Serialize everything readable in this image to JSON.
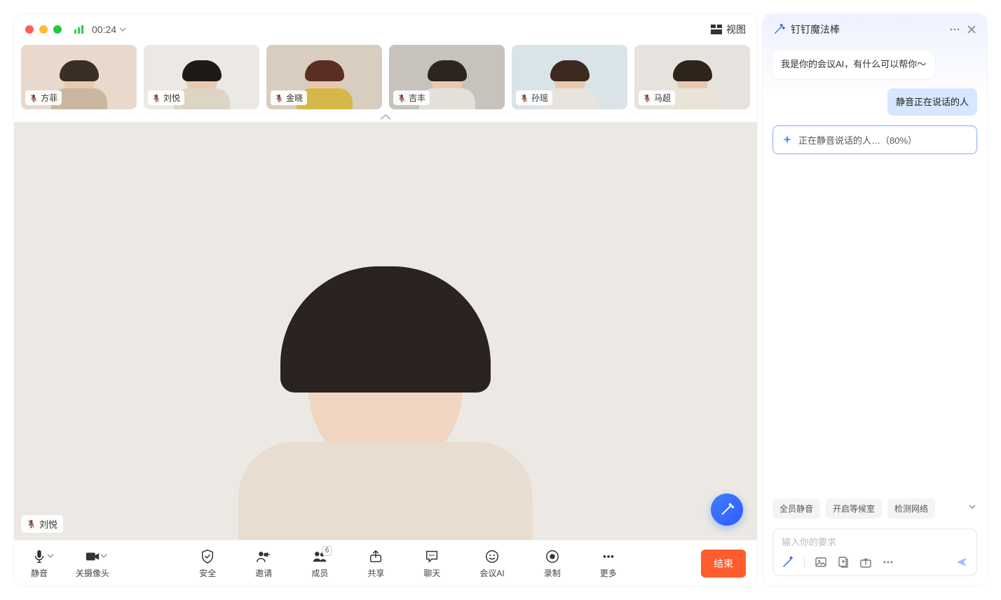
{
  "header": {
    "timer": "00:24",
    "view_label": "视图"
  },
  "participants": [
    {
      "name": "方菲",
      "bg": "#e8d9cc",
      "hair": "#3a2e26",
      "shirt": "#c9b89f"
    },
    {
      "name": "刘悦",
      "bg": "#ece9e5",
      "hair": "#1f1a17",
      "shirt": "#ded4c4"
    },
    {
      "name": "金晓",
      "bg": "#d9cdbf",
      "hair": "#5a2e22",
      "shirt": "#d4b84a"
    },
    {
      "name": "吉丰",
      "bg": "#c7c2bb",
      "hair": "#2b241f",
      "shirt": "#e3e0da"
    },
    {
      "name": "孙瑶",
      "bg": "#d9e4e9",
      "hair": "#3c2a20",
      "shirt": "#e8e3dc"
    },
    {
      "name": "马超",
      "bg": "#e6e3de",
      "hair": "#2e241c",
      "shirt": "#eae4d8"
    }
  ],
  "speaker": {
    "name": "刘悦"
  },
  "controls": {
    "mute": "静音",
    "camera": "关摄像头",
    "security": "安全",
    "invite": "邀请",
    "members": "成员",
    "members_count": "6",
    "share": "共享",
    "chat": "聊天",
    "ai": "会议AI",
    "record": "录制",
    "more": "更多",
    "end": "结束"
  },
  "ai_panel": {
    "title": "钉钉魔法棒",
    "greeting": "我是你的会议AI，有什么可以帮你～",
    "user_msg": "静音正在说话的人",
    "progress": "正在静音说话的人…（80%）",
    "chips": [
      "全员静音",
      "开启等候室",
      "检测网络"
    ],
    "placeholder": "输入你的要求"
  }
}
